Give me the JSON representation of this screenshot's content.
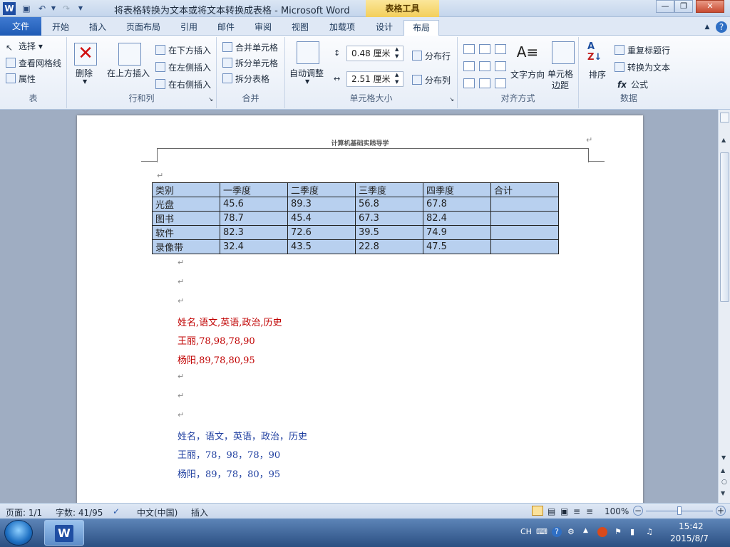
{
  "window": {
    "title": "将表格转换为文本或将文本转换成表格 - Microsoft Word",
    "context_tab_group": "表格工具",
    "app_icon": "W"
  },
  "tabs": [
    "文件",
    "开始",
    "插入",
    "页面布局",
    "引用",
    "邮件",
    "审阅",
    "视图",
    "加载项",
    "设计",
    "布局"
  ],
  "ribbon": {
    "table_group": {
      "label": "表",
      "select": "选择",
      "gridlines": "查看网格线",
      "properties": "属性"
    },
    "rows_cols_group": {
      "label": "行和列",
      "delete": "删除",
      "insert_above": "在上方插入",
      "insert_below": "在下方插入",
      "insert_left": "在左侧插入",
      "insert_right": "在右侧插入"
    },
    "merge_group": {
      "label": "合并",
      "merge_cells": "合并单元格",
      "split_cells": "拆分单元格",
      "split_table": "拆分表格"
    },
    "cell_size_group": {
      "label": "单元格大小",
      "autofit": "自动调整",
      "height": "0.48 厘米",
      "width": "2.51 厘米",
      "distribute_rows": "分布行",
      "distribute_cols": "分布列"
    },
    "alignment_group": {
      "label": "对齐方式",
      "text_direction": "文字方向",
      "cell_margins_1": "单元格",
      "cell_margins_2": "边距"
    },
    "data_group": {
      "label": "数据",
      "sort": "排序",
      "repeat_header": "重复标题行",
      "convert_to_text": "转换为文本",
      "formula": "公式"
    }
  },
  "document": {
    "header": "计算机基础实践导学",
    "table": {
      "header": [
        "类别",
        "一季度",
        "二季度",
        "三季度",
        "四季度",
        "合计"
      ],
      "rows": [
        [
          "光盘",
          "45.6",
          "89.3",
          "56.8",
          "67.8",
          ""
        ],
        [
          "图书",
          "78.7",
          "45.4",
          "67.3",
          "82.4",
          ""
        ],
        [
          "软件",
          "82.3",
          "72.6",
          "39.5",
          "74.9",
          ""
        ],
        [
          "录像带",
          "32.4",
          "43.5",
          "22.8",
          "47.5",
          ""
        ]
      ]
    },
    "red_lines": [
      "姓名,语文,英语,政治,历史",
      "王丽,78,98,78,90",
      "杨阳,89,78,80,95"
    ],
    "blue_lines": [
      "姓名，语文，英语，政治，历史",
      "王丽，78，98，78，90",
      "杨阳，89，78，80，95"
    ]
  },
  "statusbar": {
    "page": "页面: 1/1",
    "words": "字数: 41/95",
    "language": "中文(中国)",
    "mode": "插入",
    "zoom": "100%"
  },
  "taskbar": {
    "lang": "CH",
    "time": "15:42",
    "date": "2015/8/7"
  }
}
